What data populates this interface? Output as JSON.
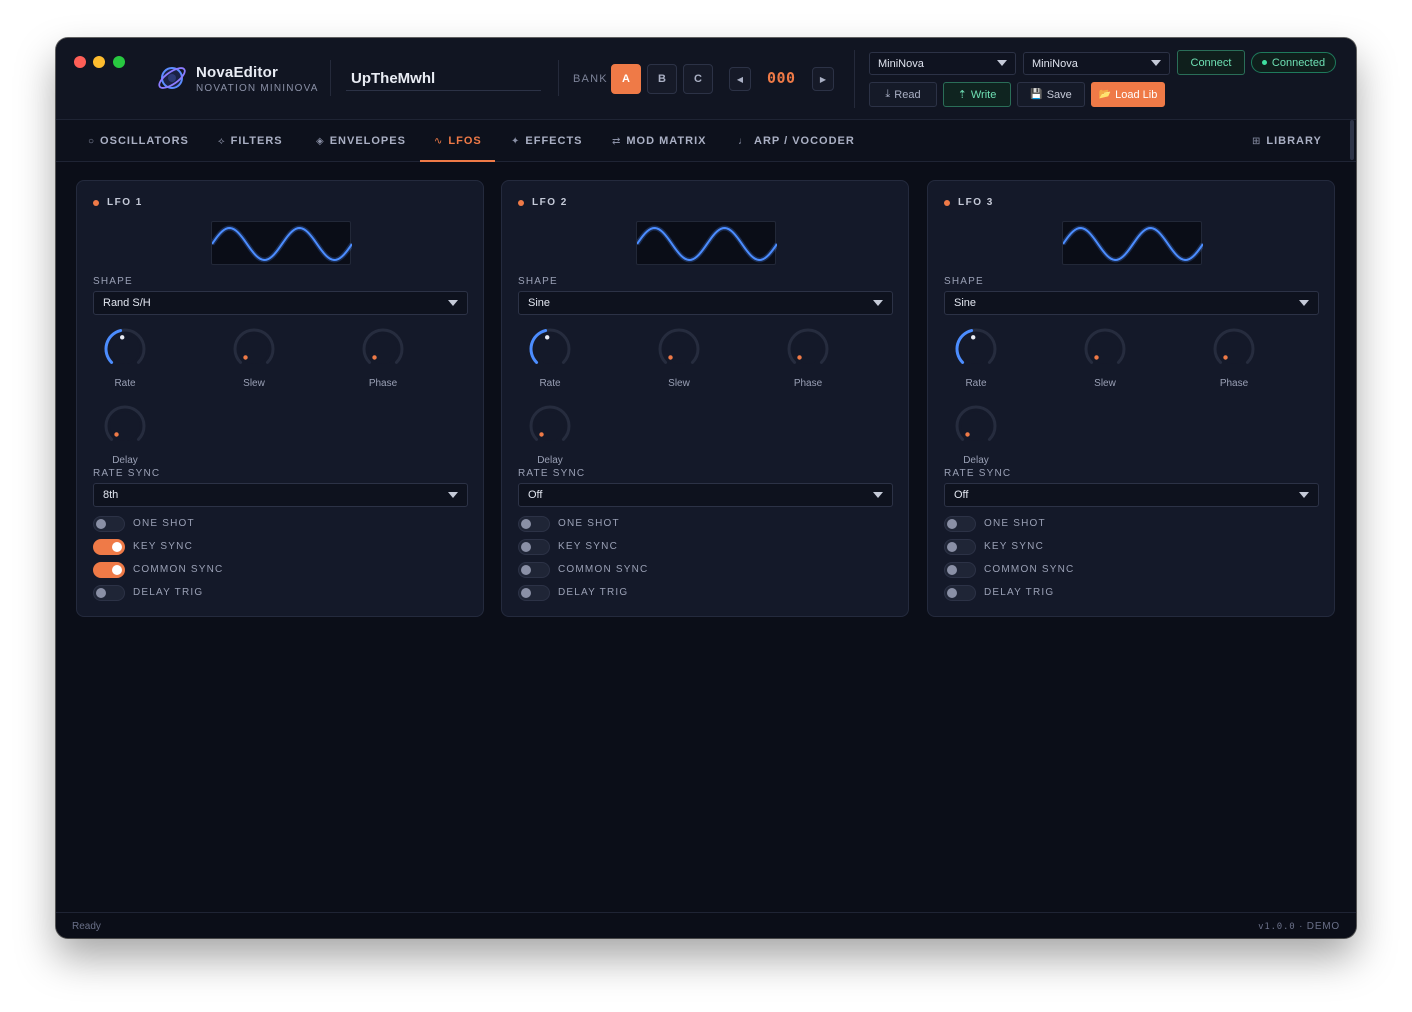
{
  "window": {
    "traffic_lights": {
      "close": "#ff5f57",
      "minimize": "#febc2e",
      "zoom": "#28c840"
    }
  },
  "brand": {
    "name": "NovaEditor",
    "subtitle": "NOVATION MININOVA"
  },
  "patch": {
    "name": "UpTheMwhl"
  },
  "bank": {
    "label": "BANK",
    "buttons": [
      "A",
      "B",
      "C"
    ],
    "active": "A",
    "program_number": "000",
    "prev_symbol": "◀",
    "next_symbol": "▶"
  },
  "midi": {
    "input_port": "MiniNova",
    "output_port": "MiniNova",
    "connect_label": "Connect",
    "status_label": "Connected"
  },
  "toolbar": {
    "read": {
      "icon": "download-icon",
      "symbol": "⤓",
      "label": "Read"
    },
    "write": {
      "icon": "upload-arrow-icon",
      "symbol": "⇡",
      "label": "Write"
    },
    "save": {
      "icon": "floppy-disk-icon",
      "symbol": "💾",
      "label": "Save"
    },
    "load_lib": {
      "icon": "folder-icon",
      "symbol": "📂",
      "label": "Load Lib"
    }
  },
  "tabs": [
    {
      "id": "oscillators",
      "icon": "○",
      "label": "OSCILLATORS"
    },
    {
      "id": "filters",
      "icon": "⟡",
      "label": "FILTERS"
    },
    {
      "id": "envelopes",
      "icon": "◈",
      "label": "ENVELOPES"
    },
    {
      "id": "lfos",
      "icon": "∿",
      "label": "LFOS",
      "active": true
    },
    {
      "id": "effects",
      "icon": "✦",
      "label": "EFFECTS"
    },
    {
      "id": "mod_matrix",
      "icon": "⇄",
      "label": "MOD MATRIX"
    },
    {
      "id": "arp_vocoder",
      "icon": "♩",
      "label": "ARP / VOCODER"
    },
    {
      "id": "library",
      "icon": "⊞",
      "label": "LIBRARY"
    }
  ],
  "panels": [
    {
      "title": "LFO 1",
      "shape_label": "SHAPE",
      "shape_value": "Rand S/H",
      "knobs": [
        {
          "label": "Rate",
          "value_fraction": 0.45,
          "active": true
        },
        {
          "label": "Slew",
          "value_fraction": 0.0
        },
        {
          "label": "Phase",
          "value_fraction": 0.0
        },
        {
          "label": "Delay",
          "value_fraction": 0.0
        }
      ],
      "rate_sync_label": "RATE SYNC",
      "rate_sync_value": "8th",
      "toggles": [
        {
          "label": "ONE SHOT",
          "on": false
        },
        {
          "label": "KEY SYNC",
          "on": true
        },
        {
          "label": "COMMON SYNC",
          "on": true
        },
        {
          "label": "DELAY TRIG",
          "on": false
        }
      ]
    },
    {
      "title": "LFO 2",
      "shape_label": "SHAPE",
      "shape_value": "Sine",
      "knobs": [
        {
          "label": "Rate",
          "value_fraction": 0.45,
          "active": true
        },
        {
          "label": "Slew",
          "value_fraction": 0.0
        },
        {
          "label": "Phase",
          "value_fraction": 0.0
        },
        {
          "label": "Delay",
          "value_fraction": 0.0
        }
      ],
      "rate_sync_label": "RATE SYNC",
      "rate_sync_value": "Off",
      "toggles": [
        {
          "label": "ONE SHOT",
          "on": false
        },
        {
          "label": "KEY SYNC",
          "on": false
        },
        {
          "label": "COMMON SYNC",
          "on": false
        },
        {
          "label": "DELAY TRIG",
          "on": false
        }
      ]
    },
    {
      "title": "LFO 3",
      "shape_label": "SHAPE",
      "shape_value": "Sine",
      "knobs": [
        {
          "label": "Rate",
          "value_fraction": 0.45,
          "active": true
        },
        {
          "label": "Slew",
          "value_fraction": 0.0
        },
        {
          "label": "Phase",
          "value_fraction": 0.0
        },
        {
          "label": "Delay",
          "value_fraction": 0.0
        }
      ],
      "rate_sync_label": "RATE SYNC",
      "rate_sync_value": "Off",
      "toggles": [
        {
          "label": "ONE SHOT",
          "on": false
        },
        {
          "label": "KEY SYNC",
          "on": false
        },
        {
          "label": "COMMON SYNC",
          "on": false
        },
        {
          "label": "DELAY TRIG",
          "on": false
        }
      ]
    }
  ],
  "status": {
    "left": "Ready",
    "version": "v1.0.0",
    "separator": "·",
    "mode": "DEMO"
  },
  "colors": {
    "accent": "#ef7a47",
    "wave": "#4c8dff",
    "success": "#3fe0a0",
    "background": "#0b0e18",
    "panel": "#141929"
  }
}
